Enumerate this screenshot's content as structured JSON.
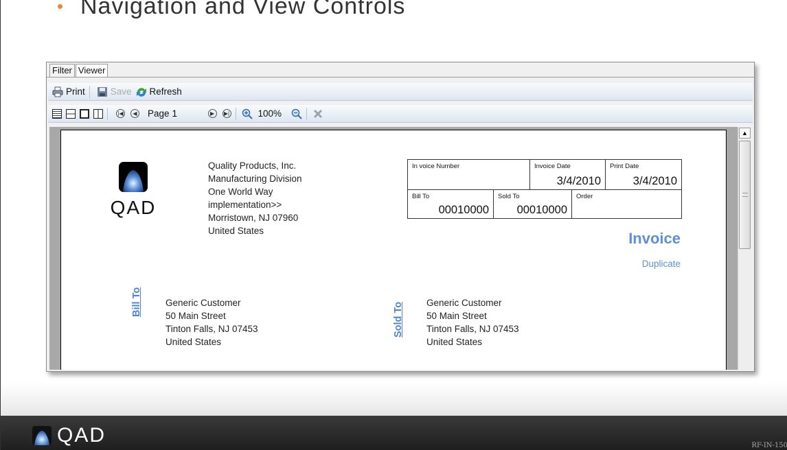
{
  "slide": {
    "title": "Navigation and View Controls",
    "footer_logo": "QAD",
    "footer_code": "RF-IN-150"
  },
  "window": {
    "tabs": [
      {
        "label": "Filter"
      },
      {
        "label": "Viewer"
      }
    ],
    "toolbar": {
      "print_label": "Print",
      "save_label": "Save",
      "refresh_label": "Refresh",
      "page_label": "Page",
      "page_value": "1",
      "zoom": "100%"
    }
  },
  "invoice": {
    "logo_text": "QAD",
    "company_lines": [
      "Quality Products, Inc.",
      "Manufacturing Division",
      "One World Way",
      "implementation>>",
      "Morristown, NJ 07960",
      "United States"
    ],
    "invoice_number_label": "In voice Number",
    "invoice_number_value": "",
    "invoice_date_label": "Invoice Date",
    "invoice_date_value": "3/4/2010",
    "print_date_label": "Print Date",
    "print_date_value": "3/4/2010",
    "bill_to_label": "Bill To",
    "bill_to_value": "00010000",
    "sold_to_label": "Sold To",
    "sold_to_value": "00010000",
    "order_label": "Order",
    "order_value": "",
    "title": "Invoice",
    "duplicate": "Duplicate",
    "bill_to_vertical": "Bill To",
    "sold_to_vertical": "Sold To",
    "bill_to_address": [
      "Generic Customer",
      "50 Main Street",
      "Tinton Falls, NJ 07453",
      "United States"
    ],
    "sold_to_address": [
      "Generic Customer",
      "50 Main Street",
      "Tinton Falls, NJ 07453",
      "United States"
    ]
  },
  "colors": {
    "accent": "#5b8fd6",
    "bullet": "#e8893a",
    "footer": "#2a2a2a"
  },
  "icons": [
    "printer-icon",
    "save-icon",
    "refresh-icon",
    "first-page-icon",
    "previous-page-icon",
    "next-page-icon",
    "last-page-icon",
    "zoom-in-icon",
    "zoom-out-icon",
    "close-icon"
  ]
}
